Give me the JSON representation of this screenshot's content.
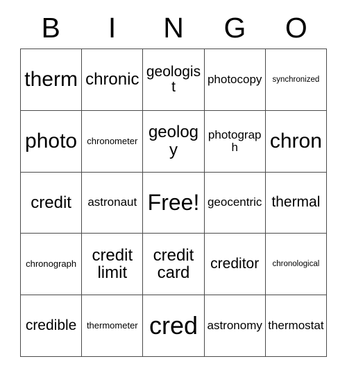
{
  "card": {
    "title_letters": [
      "B",
      "I",
      "N",
      "G",
      "O"
    ],
    "columns": 5,
    "rows": 5,
    "free_space_label": "Free!",
    "free_space_position": {
      "row": 3,
      "column": 3
    },
    "colors": {
      "background": "#ffffff",
      "text": "#000000",
      "grid_line": "#4a4a4a"
    },
    "cells": [
      [
        {
          "text": "therm",
          "size": "lg"
        },
        {
          "text": "chronic",
          "size": "md"
        },
        {
          "text": "geologist",
          "size": "sm"
        },
        {
          "text": "photocopy",
          "size": "xs"
        },
        {
          "text": "synchronized",
          "size": "tiny"
        }
      ],
      [
        {
          "text": "photo",
          "size": "lg"
        },
        {
          "text": "chronometer",
          "size": "xxs"
        },
        {
          "text": "geology",
          "size": "md"
        },
        {
          "text": "photograph",
          "size": "xs"
        },
        {
          "text": "chron",
          "size": "lg"
        }
      ],
      [
        {
          "text": "credit",
          "size": "md"
        },
        {
          "text": "astronaut",
          "size": "xs"
        },
        {
          "text": "Free!",
          "size": "xl"
        },
        {
          "text": "geocentric",
          "size": "xs"
        },
        {
          "text": "thermal",
          "size": "sm"
        }
      ],
      [
        {
          "text": "chronograph",
          "size": "xxs"
        },
        {
          "text": "credit limit",
          "size": "md"
        },
        {
          "text": "credit card",
          "size": "md"
        },
        {
          "text": "creditor",
          "size": "sm"
        },
        {
          "text": "chronological",
          "size": "tiny"
        }
      ],
      [
        {
          "text": "credible",
          "size": "sm"
        },
        {
          "text": "thermometer",
          "size": "xxs"
        },
        {
          "text": "cred",
          "size": "xxl"
        },
        {
          "text": "astronomy",
          "size": "xs"
        },
        {
          "text": "thermostat",
          "size": "xs"
        }
      ]
    ]
  }
}
